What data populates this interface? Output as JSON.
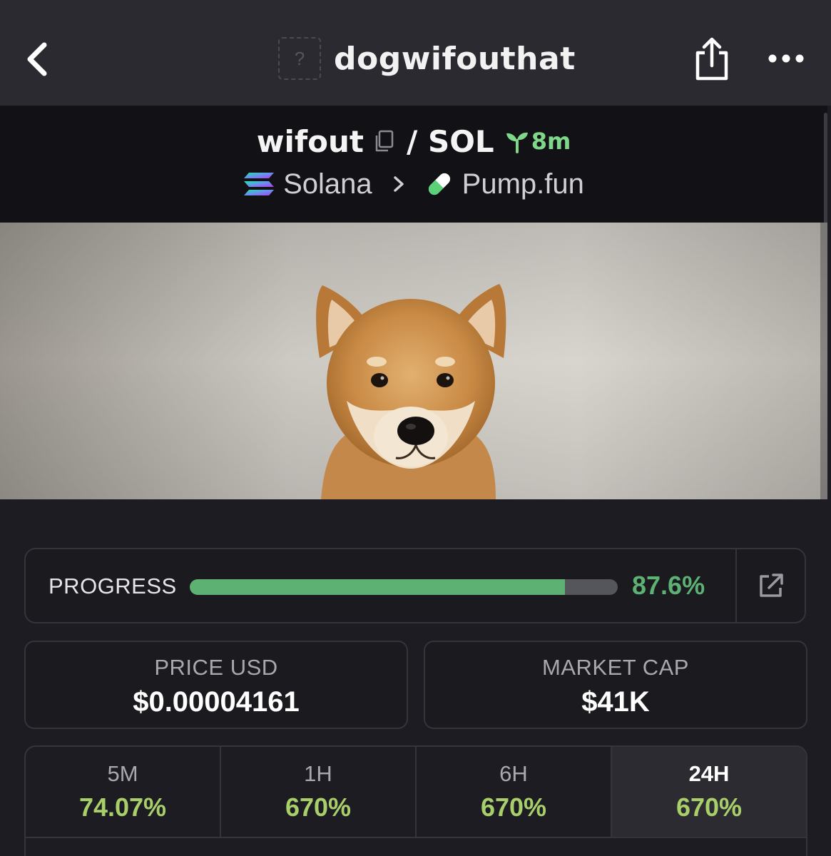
{
  "header": {
    "title": "dogwifouthat",
    "avatar_placeholder": "?",
    "icons": [
      "back-chevron-icon",
      "share-icon",
      "more-dots-icon"
    ]
  },
  "pair": {
    "base": "wifout",
    "quote": "/ SOL",
    "age": "8m",
    "chain": "Solana",
    "dex": "Pump.fun",
    "icons": [
      "copy-icon",
      "sprout-icon",
      "solana-logo-icon",
      "chevron-right-icon",
      "pill-icon"
    ]
  },
  "banner": {
    "subject": "shiba-inu-dog-photo"
  },
  "progress": {
    "label": "PROGRESS",
    "value_text": "87.6%",
    "fraction": 0.876,
    "accent": "#5cb173"
  },
  "stats": {
    "price": {
      "label": "PRICE USD",
      "value": "$0.00004161"
    },
    "mcap": {
      "label": "MARKET CAP",
      "value": "$41K"
    }
  },
  "timeframes": [
    {
      "label": "5M",
      "value": "74.07%"
    },
    {
      "label": "1H",
      "value": "670%"
    },
    {
      "label": "6H",
      "value": "670%"
    },
    {
      "label": "24H",
      "value": "670%",
      "active": true
    }
  ],
  "colors": {
    "positive": "#a8cf6a",
    "background": "#1c1c22"
  }
}
